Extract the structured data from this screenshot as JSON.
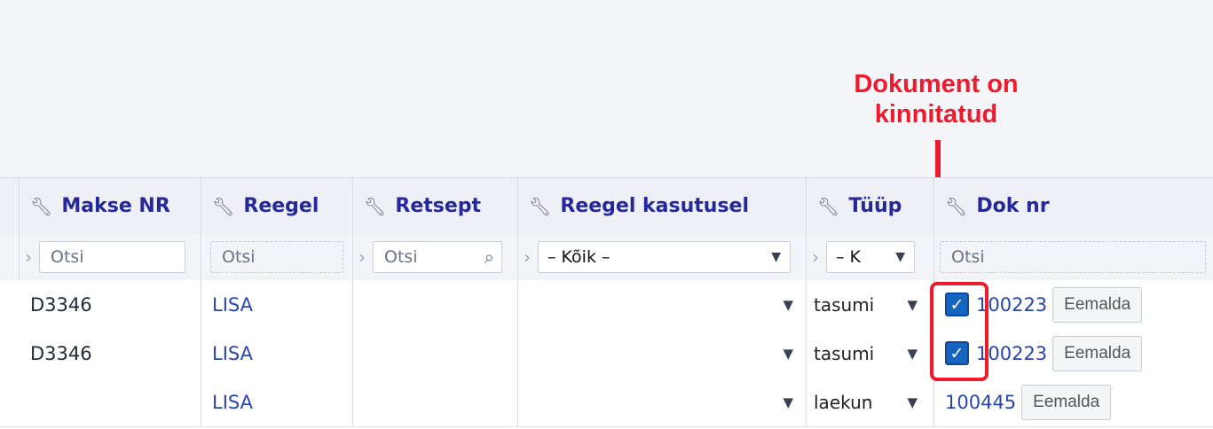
{
  "annotation": {
    "line1": "Dokument on",
    "line2": "kinnitatud"
  },
  "columns": [
    {
      "key": "makse_nr",
      "label": "Makse NR"
    },
    {
      "key": "reegel",
      "label": "Reegel"
    },
    {
      "key": "retsept",
      "label": "Retsept"
    },
    {
      "key": "reegel_kasutusel",
      "label": "Reegel kasutusel"
    },
    {
      "key": "tuup",
      "label": "Tüüp"
    },
    {
      "key": "dok_nr",
      "label": "Dok nr"
    }
  ],
  "filters": {
    "makse_nr": "Otsi",
    "reegel": "Otsi",
    "retsept": "Otsi",
    "reegel_kasutusel": "– Kõik –",
    "tuup": "– K",
    "dok_nr": "Otsi"
  },
  "rows": [
    {
      "makse_nr": "D3346",
      "reegel": "LISA",
      "tuup": "tasumi",
      "checked": true,
      "dok_nr": "100223",
      "remove": "Eemalda"
    },
    {
      "makse_nr": "D3346",
      "reegel": "LISA",
      "tuup": "tasumi",
      "checked": true,
      "dok_nr": "100223",
      "remove": "Eemalda"
    },
    {
      "makse_nr": "",
      "reegel": "LISA",
      "tuup": "laekun",
      "checked": false,
      "dok_nr": "100445",
      "remove": "Eemalda"
    }
  ],
  "colors": {
    "annotation_red": "#ee1b2e",
    "header_text": "#25289a",
    "link": "#2845b0",
    "checkbox": "#1565c0"
  },
  "icons": {
    "header": "wrench-icon",
    "filter": "chevron-right-icon",
    "search": "search-icon",
    "dropdown": "triangle-down-icon",
    "check": "checkmark-icon"
  }
}
